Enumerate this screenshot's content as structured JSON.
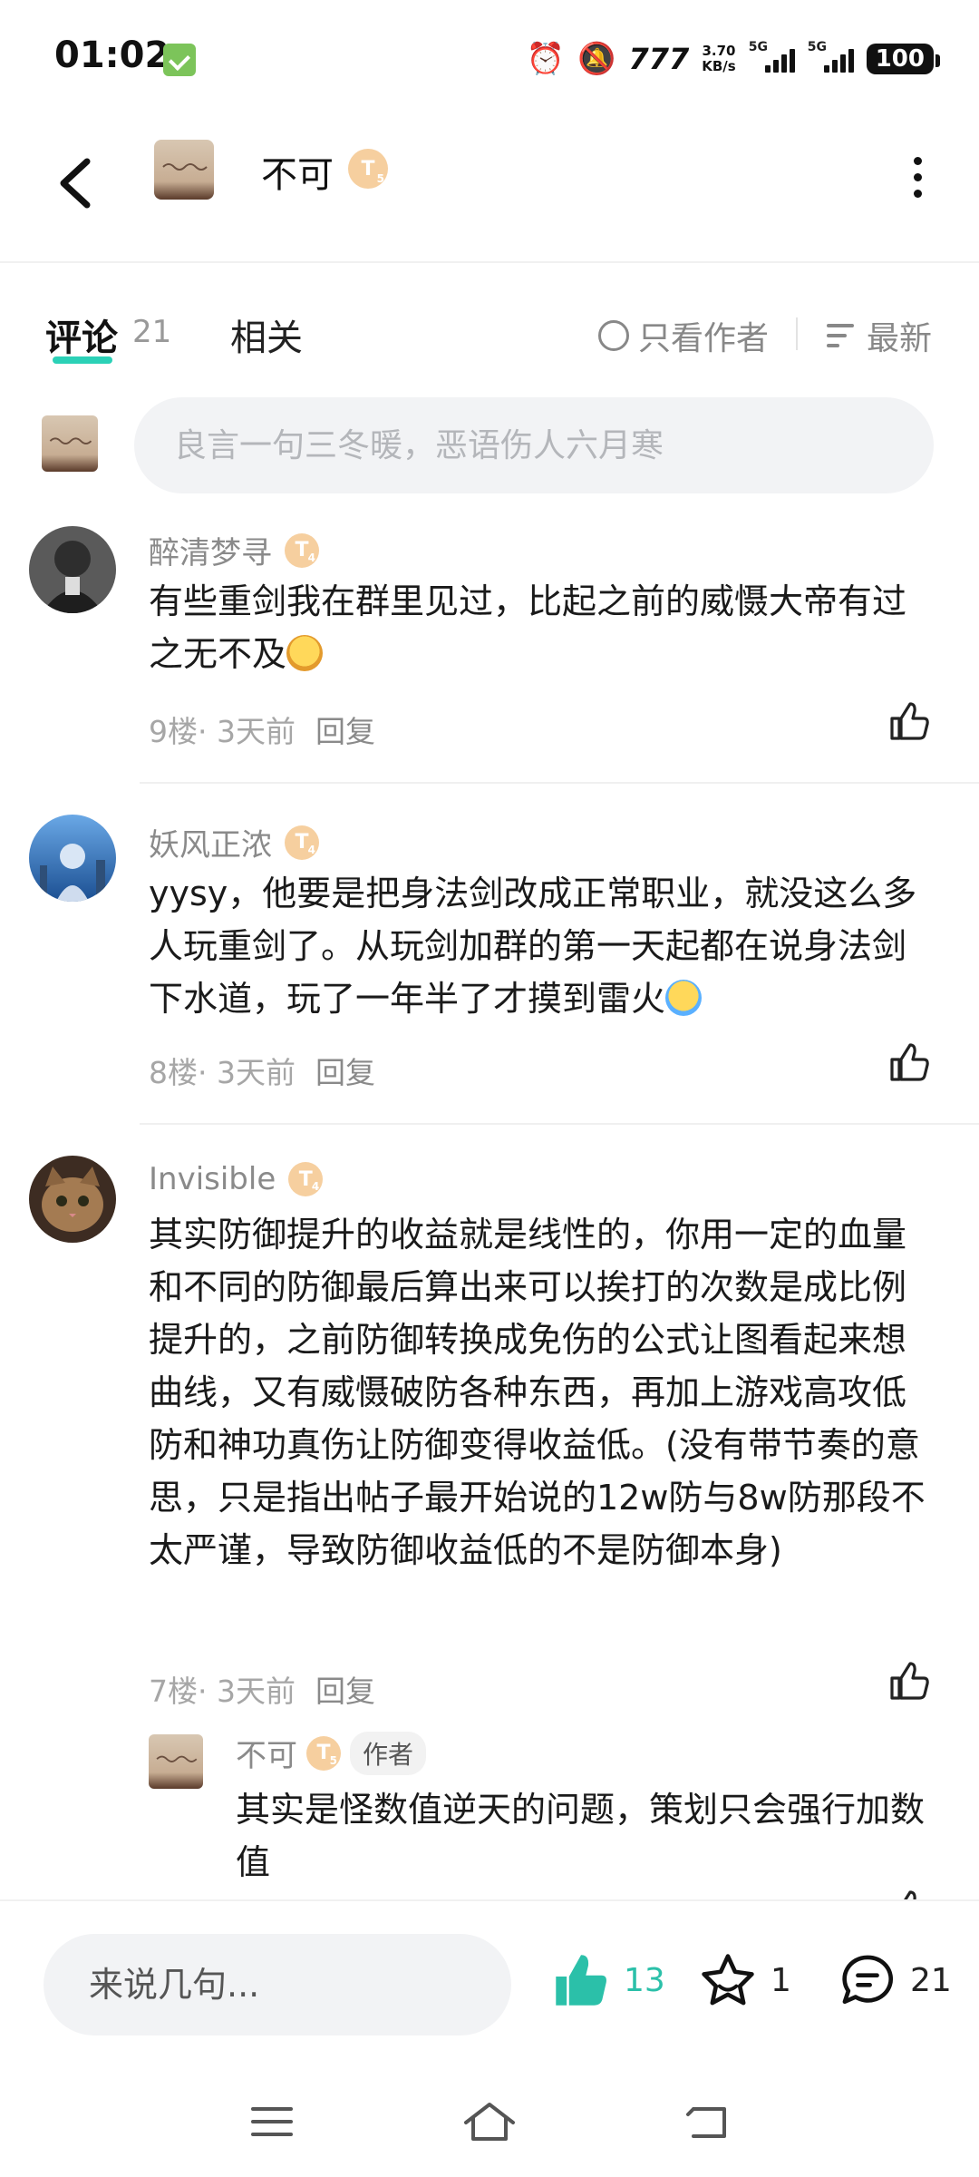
{
  "status_bar": {
    "time": "01:02",
    "net_speed_value": "3.70",
    "net_speed_unit": "KB/s",
    "signal1_tag": "5G",
    "signal2_tag": "5G",
    "battery": "100"
  },
  "header": {
    "author_name": "不可",
    "level_badge": "T",
    "level_sub": "5"
  },
  "tabs": {
    "comments_label": "评论",
    "comments_count": "21",
    "related_label": "相关",
    "author_only_label": "只看作者",
    "sort_label": "最新"
  },
  "compose": {
    "placeholder": "良言一句三冬暖，恶语伤人六月寒"
  },
  "comments": [
    {
      "name": "醉清梦寻",
      "badge": "T",
      "badge_sub": "4",
      "text": "有些重剑我在群里见过，比起之前的威慑大帝有过之无不及",
      "floor": "9楼",
      "time": " · 3天前",
      "reply": "回复"
    },
    {
      "name": "妖风正浓",
      "badge": "T",
      "badge_sub": "4",
      "text": "yysy，他要是把身法剑改成正常职业，就没这么多人玩重剑了。从玩剑加群的第一天起都在说身法剑下水道，玩了一年半了才摸到雷火",
      "floor": "8楼",
      "time": " · 3天前",
      "reply": "回复"
    },
    {
      "name": "Invisible",
      "badge": "T",
      "badge_sub": "4",
      "text": "其实防御提升的收益就是线性的，你用一定的血量和不同的防御最后算出来可以挨打的次数是成比例提升的，之前防御转换成免伤的公式让图看起来想曲线，又有威慑破防各种东西，再加上游戏高攻低防和神功真伤让防御变得收益低。(没有带节奏的意思，只是指出帖子最开始说的12w防与8w防那段不太严谨，导致防御收益低的不是防御本身)",
      "floor": "7楼",
      "time": " · 3天前",
      "reply": "回复"
    }
  ],
  "sub_reply": {
    "name": "不可",
    "badge": "T",
    "badge_sub": "5",
    "author_tag": "作者",
    "text": "其实是怪数值逆天的问题，策划只会强行加数值"
  },
  "bottom_bar": {
    "input_placeholder": "来说几句...",
    "like_count": "13",
    "fav_count": "1",
    "comment_count": "21",
    "accent_color": "#2bc0a9"
  }
}
